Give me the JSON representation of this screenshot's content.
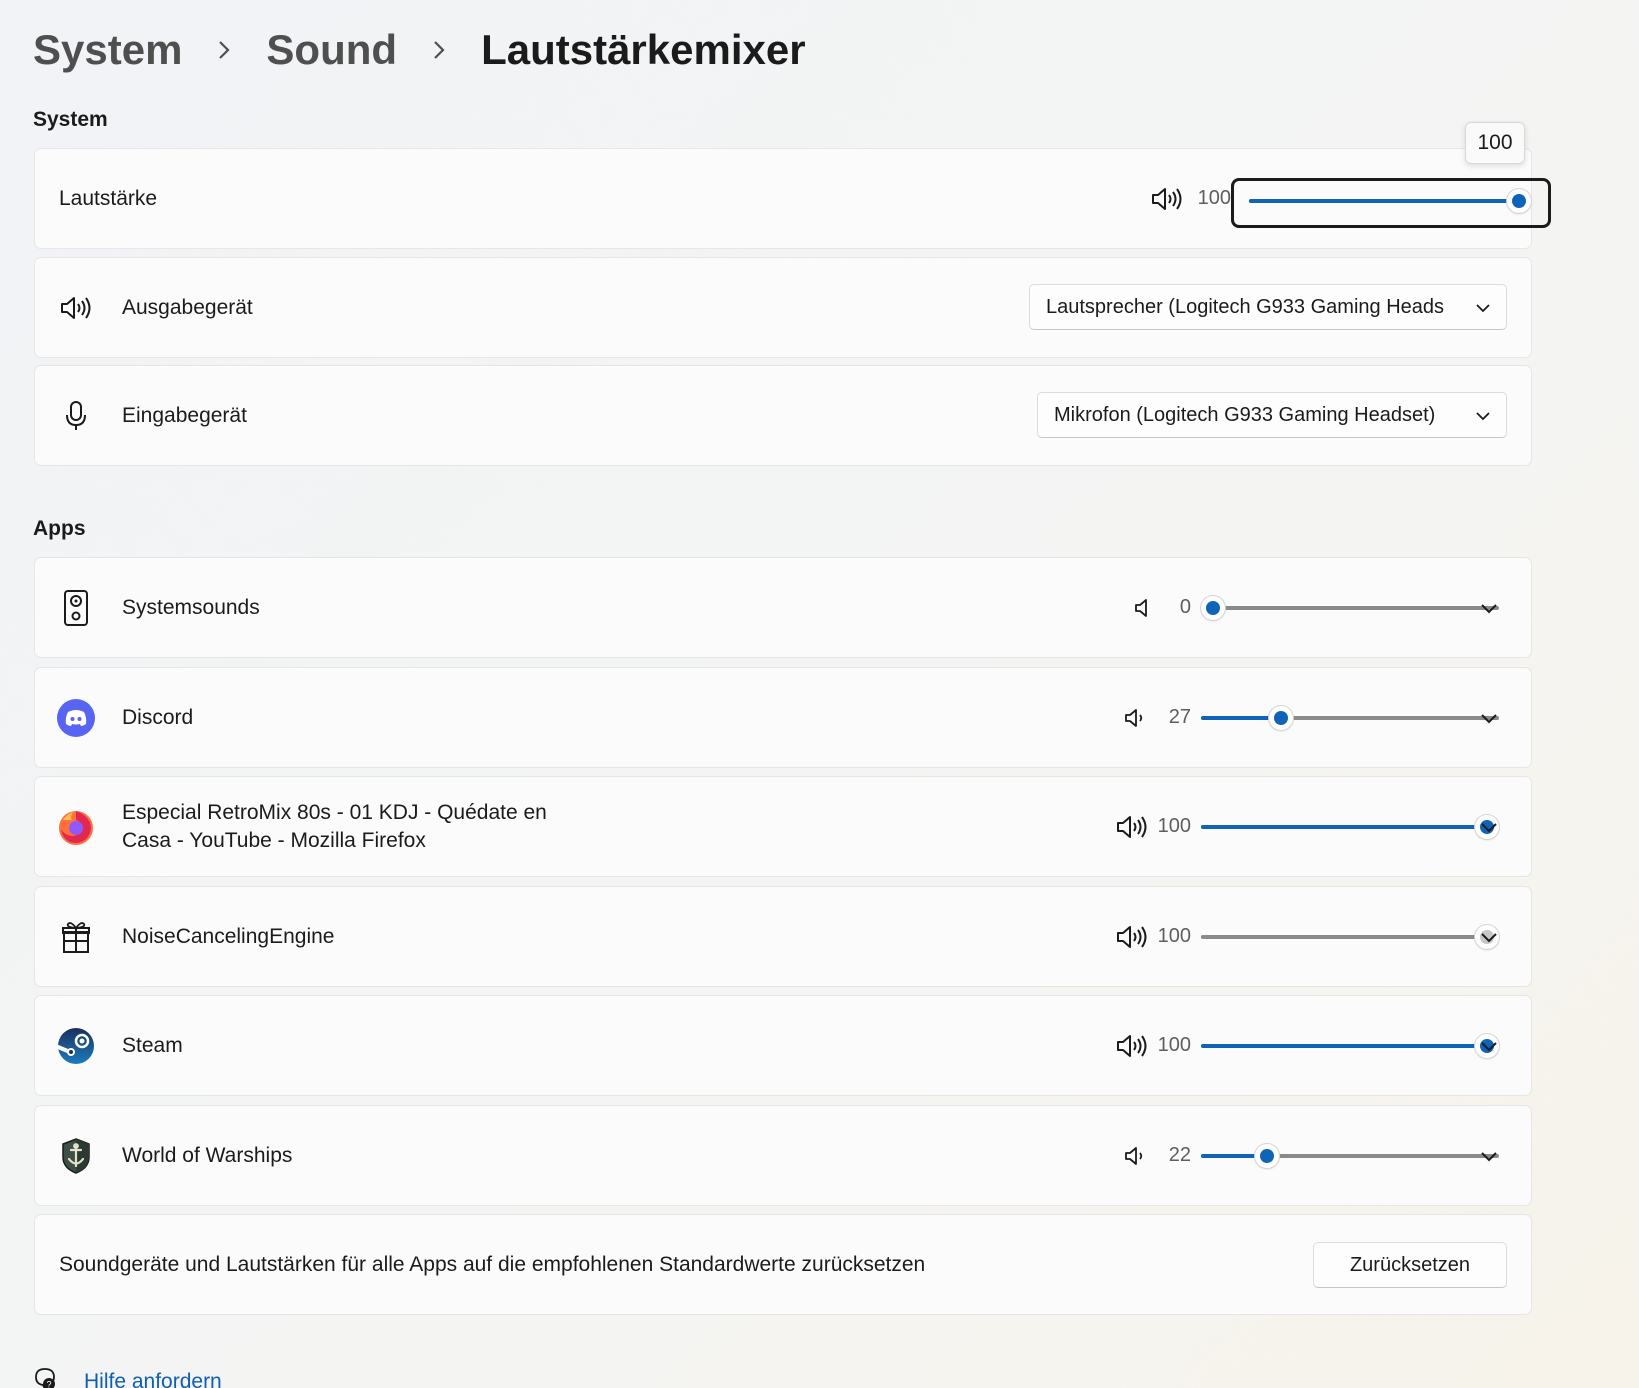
{
  "breadcrumb": {
    "level1": "System",
    "level2": "Sound",
    "current": "Lautstärkemixer"
  },
  "system_section": {
    "heading": "System",
    "volume": {
      "label": "Lautstärke",
      "value": 100,
      "value_text": "100",
      "tooltip": "100",
      "icon": "speaker-high-icon"
    },
    "output": {
      "label": "Ausgabegerät",
      "icon": "speaker-high-icon",
      "selected": "Lautsprecher (Logitech G933 Gaming Heads"
    },
    "input": {
      "label": "Eingabegerät",
      "icon": "microphone-icon",
      "selected": "Mikrofon (Logitech G933 Gaming Headset)"
    }
  },
  "apps_section": {
    "heading": "Apps",
    "apps": [
      {
        "name": "Systemsounds",
        "icon": "system-sounds-icon",
        "volume": 0,
        "value_text": "0",
        "vol_icon": "speaker-low-icon",
        "disabled": false
      },
      {
        "name": "Discord",
        "icon": "discord-icon",
        "volume": 27,
        "value_text": "27",
        "vol_icon": "speaker-low-icon",
        "disabled": false
      },
      {
        "name_line1": "Especial RetroMix 80s - 01 KDJ - Quédate en",
        "name_line2": "Casa - YouTube - Mozilla Firefox",
        "icon": "firefox-icon",
        "volume": 100,
        "value_text": "100",
        "vol_icon": "speaker-high-icon",
        "disabled": false
      },
      {
        "name": "NoiseCancelingEngine",
        "icon": "gift-box-icon",
        "volume": 100,
        "value_text": "100",
        "vol_icon": "speaker-high-icon",
        "disabled": true
      },
      {
        "name": "Steam",
        "icon": "steam-icon",
        "volume": 100,
        "value_text": "100",
        "vol_icon": "speaker-high-icon",
        "disabled": false
      },
      {
        "name": "World of Warships",
        "icon": "world-of-warships-icon",
        "volume": 22,
        "value_text": "22",
        "vol_icon": "speaker-low-icon",
        "disabled": false
      }
    ]
  },
  "reset": {
    "text": "Soundgeräte und Lautstärken für alle Apps auf die empfohlenen Standardwerte zurücksetzen",
    "button": "Zurücksetzen"
  },
  "help": {
    "link": "Hilfe anfordern",
    "icon": "help-icon"
  },
  "colors": {
    "accent": "#0f64b8",
    "link": "#0f5fae",
    "track": "#8a8a8a",
    "discord": "#5865f2"
  }
}
